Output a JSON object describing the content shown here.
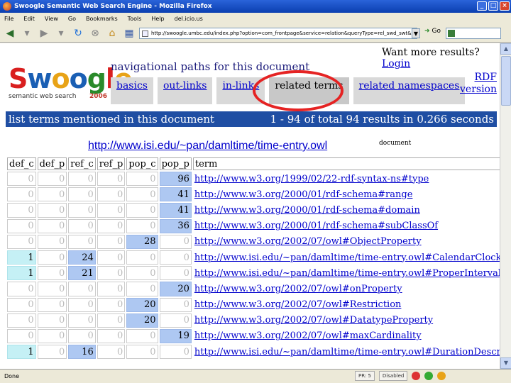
{
  "window": {
    "title": "Swoogle Semantic Web Search Engine - Mozilla Firefox"
  },
  "menu": [
    "File",
    "Edit",
    "View",
    "Go",
    "Bookmarks",
    "Tools",
    "Help",
    "del.icio.us"
  ],
  "address": {
    "url": "http://swoogle.umbc.edu/index.php?option=com_frontpage&service=relation&queryType=rel_swd_swt&searchString=http%3A%2F%2Fwww.isi.edu%2F~pan%2Fdamltime%2Ftime-entry.owl",
    "go_label": "Go"
  },
  "status": {
    "text": "Done",
    "cells": [
      "PR: 5",
      "Disabled"
    ]
  },
  "header": {
    "login_prompt": "Want more results?",
    "login_link": "Login",
    "logo_letters": [
      "S",
      "w",
      "o",
      "o",
      "g",
      "l",
      "e"
    ],
    "tagline": "semantic web search",
    "year": "2006",
    "nav_title": "navigational paths for this document",
    "tabs": [
      {
        "label": "basics",
        "active": false
      },
      {
        "label": "out-links",
        "active": false
      },
      {
        "label": "in-links",
        "active": false
      },
      {
        "label": "related terms",
        "active": true
      },
      {
        "label": "related namespaces",
        "active": false
      }
    ],
    "rdf_line1": "RDF",
    "rdf_line2": "version"
  },
  "results_bar": {
    "left": "list terms mentioned in this document",
    "right": "1 - 94 of total 94 results in 0.266 seconds"
  },
  "document": {
    "url": "http://www.isi.edu/~pan/damltime/time-entry.owl",
    "tag": "document"
  },
  "table": {
    "headers": [
      "def_c",
      "def_p",
      "ref_c",
      "ref_p",
      "pop_c",
      "pop_p",
      "term"
    ],
    "rows": [
      {
        "def_c": "0",
        "def_p": "0",
        "ref_c": "0",
        "ref_p": "0",
        "pop_c": "0",
        "pop_p": "96",
        "term": "http://www.w3.org/1999/02/22-rdf-syntax-ns#type",
        "hl": [
          "pop_p"
        ]
      },
      {
        "def_c": "0",
        "def_p": "0",
        "ref_c": "0",
        "ref_p": "0",
        "pop_c": "0",
        "pop_p": "41",
        "term": "http://www.w3.org/2000/01/rdf-schema#range",
        "hl": [
          "pop_p"
        ]
      },
      {
        "def_c": "0",
        "def_p": "0",
        "ref_c": "0",
        "ref_p": "0",
        "pop_c": "0",
        "pop_p": "41",
        "term": "http://www.w3.org/2000/01/rdf-schema#domain",
        "hl": [
          "pop_p"
        ]
      },
      {
        "def_c": "0",
        "def_p": "0",
        "ref_c": "0",
        "ref_p": "0",
        "pop_c": "0",
        "pop_p": "36",
        "term": "http://www.w3.org/2000/01/rdf-schema#subClassOf",
        "hl": [
          "pop_p"
        ]
      },
      {
        "def_c": "0",
        "def_p": "0",
        "ref_c": "0",
        "ref_p": "0",
        "pop_c": "28",
        "pop_p": "0",
        "term": "http://www.w3.org/2002/07/owl#ObjectProperty",
        "hl": [
          "pop_c"
        ]
      },
      {
        "def_c": "1",
        "def_p": "0",
        "ref_c": "24",
        "ref_p": "0",
        "pop_c": "0",
        "pop_p": "0",
        "term": "http://www.isi.edu/~pan/damltime/time-entry.owl#CalendarClockDescription",
        "hl": [
          "def_c",
          "ref_c"
        ]
      },
      {
        "def_c": "1",
        "def_p": "0",
        "ref_c": "21",
        "ref_p": "0",
        "pop_c": "0",
        "pop_p": "0",
        "term": "http://www.isi.edu/~pan/damltime/time-entry.owl#ProperIntervalThing",
        "hl": [
          "def_c",
          "ref_c"
        ]
      },
      {
        "def_c": "0",
        "def_p": "0",
        "ref_c": "0",
        "ref_p": "0",
        "pop_c": "0",
        "pop_p": "20",
        "term": "http://www.w3.org/2002/07/owl#onProperty",
        "hl": [
          "pop_p"
        ]
      },
      {
        "def_c": "0",
        "def_p": "0",
        "ref_c": "0",
        "ref_p": "0",
        "pop_c": "20",
        "pop_p": "0",
        "term": "http://www.w3.org/2002/07/owl#Restriction",
        "hl": [
          "pop_c"
        ]
      },
      {
        "def_c": "0",
        "def_p": "0",
        "ref_c": "0",
        "ref_p": "0",
        "pop_c": "20",
        "pop_p": "0",
        "term": "http://www.w3.org/2002/07/owl#DatatypeProperty",
        "hl": [
          "pop_c"
        ]
      },
      {
        "def_c": "0",
        "def_p": "0",
        "ref_c": "0",
        "ref_p": "0",
        "pop_c": "0",
        "pop_p": "19",
        "term": "http://www.w3.org/2002/07/owl#maxCardinality",
        "hl": [
          "pop_p"
        ]
      },
      {
        "def_c": "1",
        "def_p": "0",
        "ref_c": "16",
        "ref_p": "0",
        "pop_c": "0",
        "pop_p": "0",
        "term": "http://www.isi.edu/~pan/damltime/time-entry.owl#DurationDescription",
        "hl": [
          "def_c",
          "ref_c"
        ]
      }
    ]
  },
  "colors": {
    "results_bar": "#1f4ea3",
    "highlight_ring": "#e52323",
    "cell_blue": "#aec8f2",
    "cell_cyan": "#c5f0f5"
  }
}
